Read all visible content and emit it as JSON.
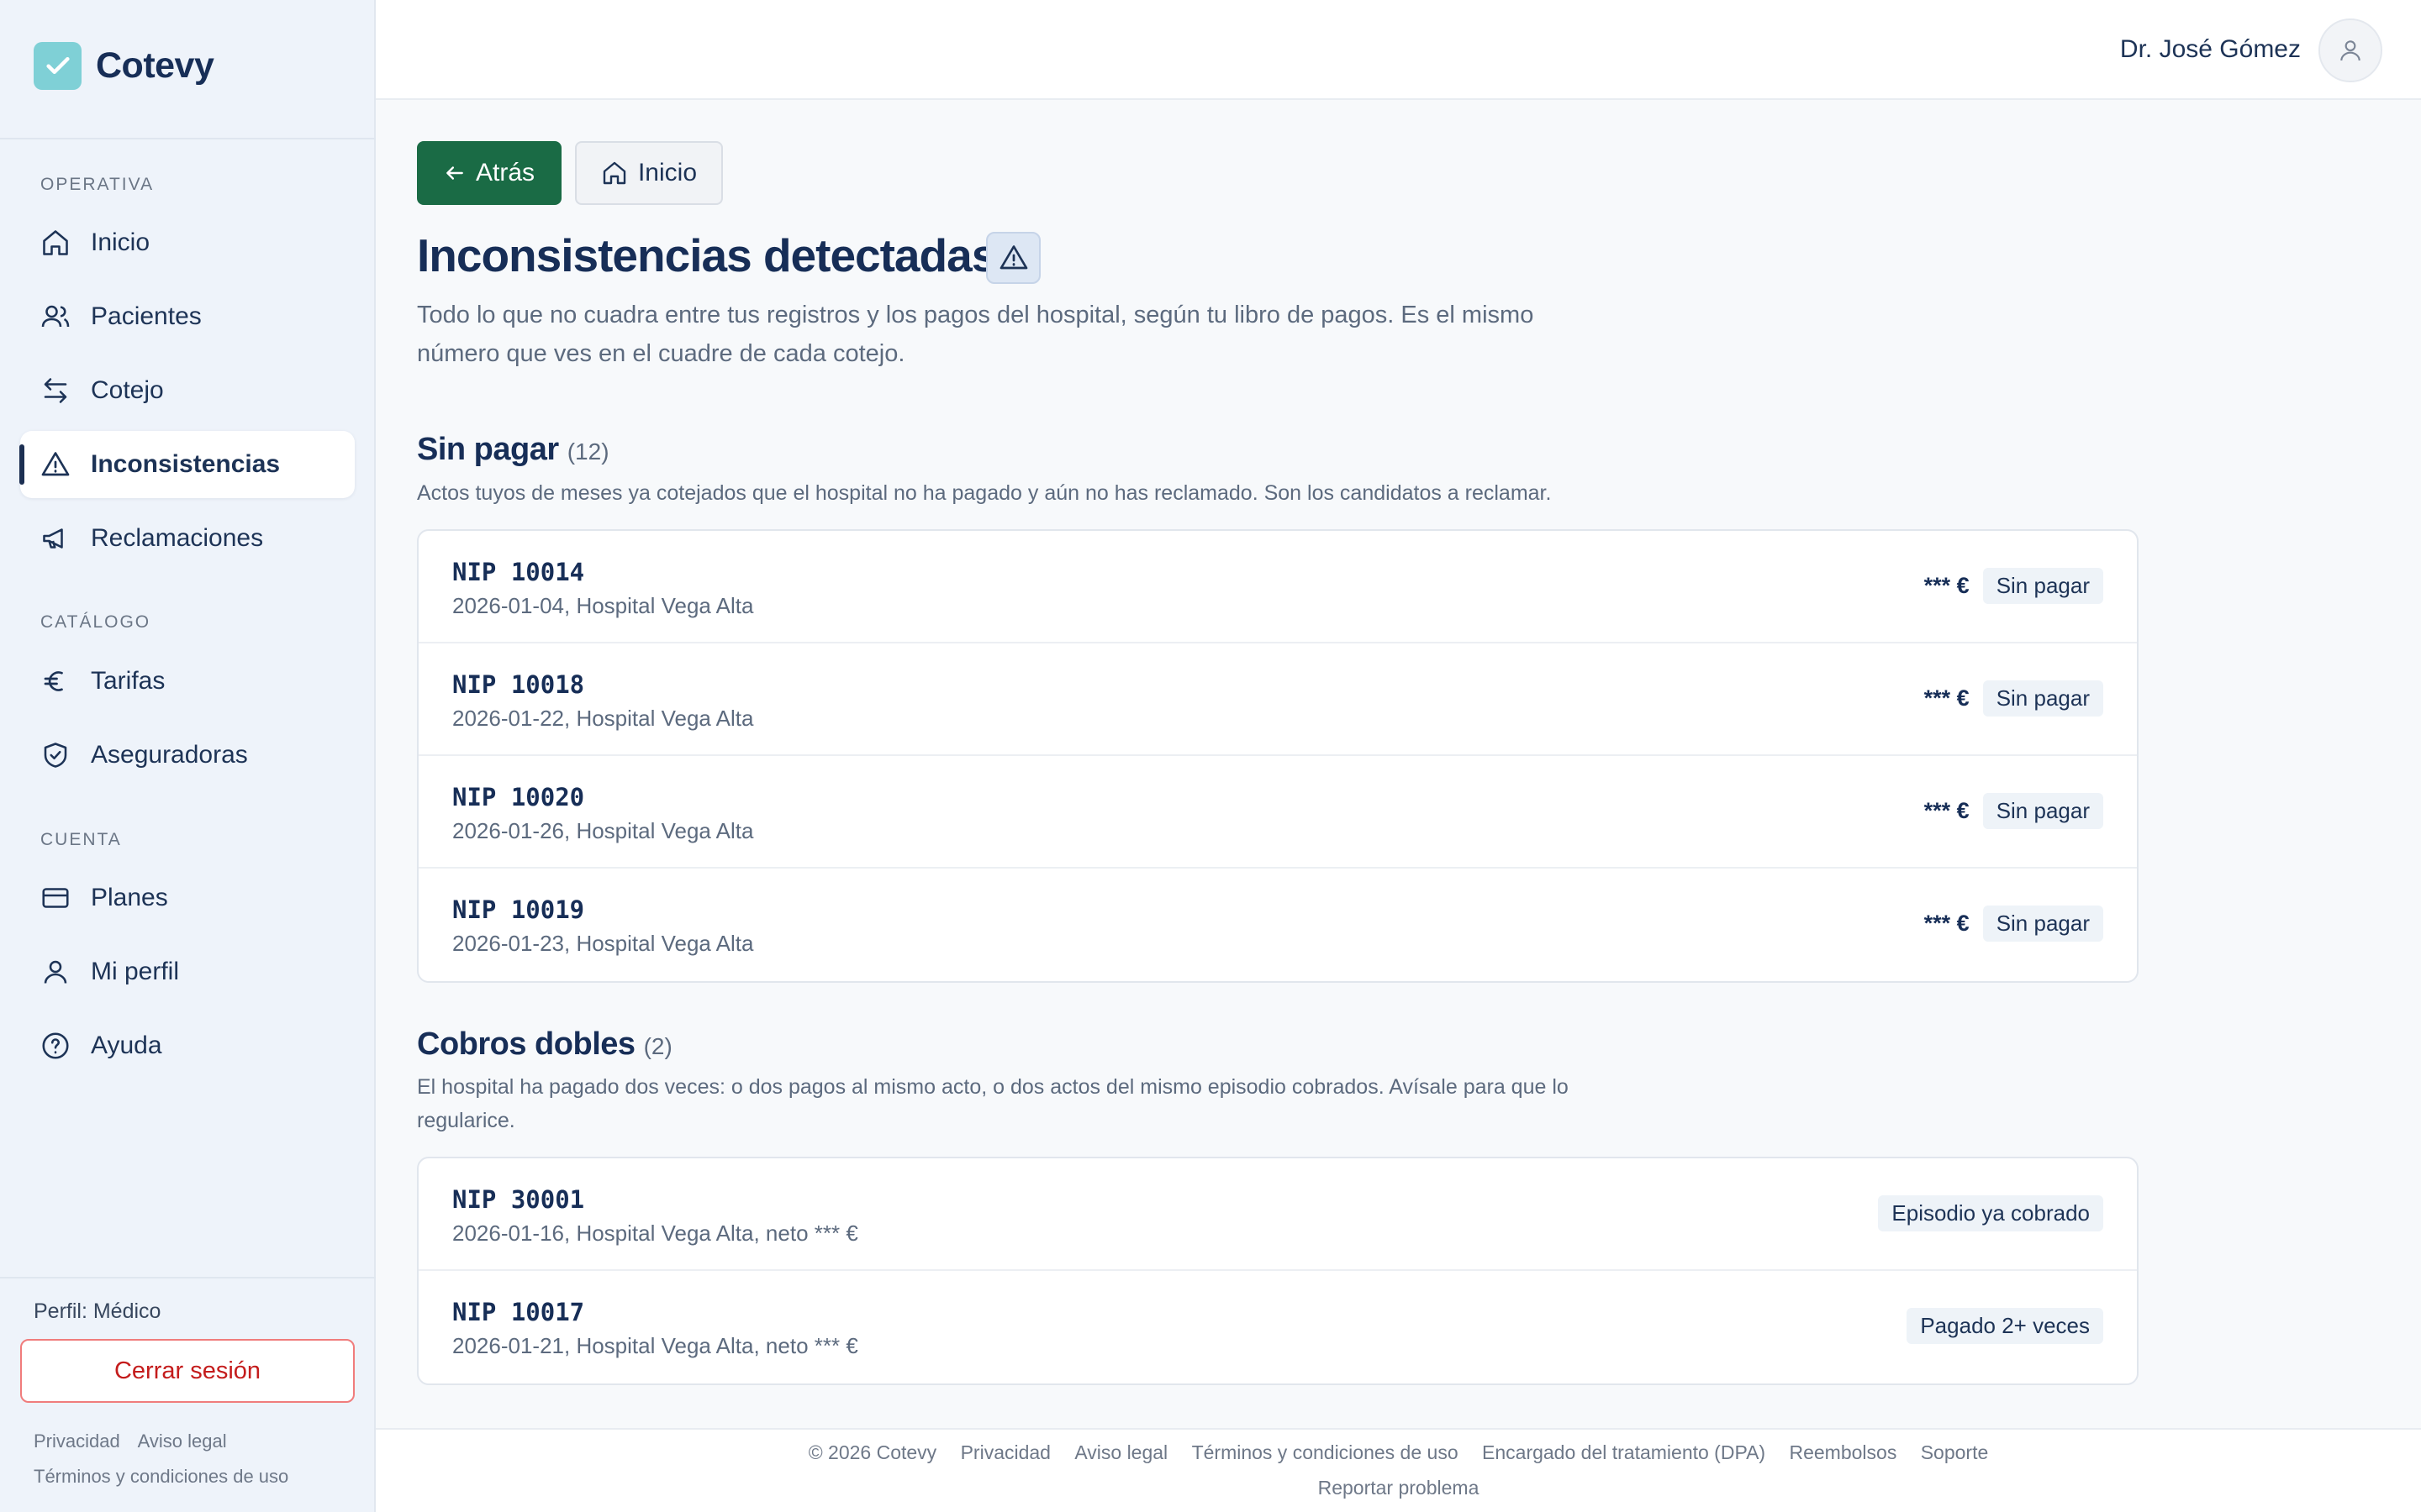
{
  "brand": {
    "name": "Cotevy"
  },
  "sidebar": {
    "sections": [
      "OPERATIVA",
      "CATÁLOGO",
      "CUENTA"
    ],
    "items": [
      {
        "label": "Inicio",
        "icon": "home-icon"
      },
      {
        "label": "Pacientes",
        "icon": "users-icon"
      },
      {
        "label": "Cotejo",
        "icon": "arrows-swap-icon"
      },
      {
        "label": "Inconsistencias",
        "icon": "warning-icon",
        "active": true
      },
      {
        "label": "Reclamaciones",
        "icon": "megaphone-icon"
      },
      {
        "label": "Tarifas",
        "icon": "euro-icon"
      },
      {
        "label": "Aseguradoras",
        "icon": "shield-check-icon"
      },
      {
        "label": "Planes",
        "icon": "credit-card-icon"
      },
      {
        "label": "Mi perfil",
        "icon": "user-icon"
      },
      {
        "label": "Ayuda",
        "icon": "help-circle-icon"
      }
    ],
    "profile_role": "Perfil: Médico",
    "logout_label": "Cerrar sesión",
    "legal_links": [
      "Privacidad",
      "Aviso legal",
      "Términos y condiciones de uso"
    ]
  },
  "topbar": {
    "user_name": "Dr. José Gómez"
  },
  "toolbar": {
    "back_label": "Atrás",
    "home_label": "Inicio"
  },
  "page": {
    "title": "Inconsistencias detectadas",
    "description": "Todo lo que no cuadra entre tus registros y los pagos del hospital, según tu libro de pagos. Es el mismo número que ves en el cuadre de cada cotejo."
  },
  "unpaid": {
    "title": "Sin pagar",
    "count": "(12)",
    "description": "Actos tuyos de meses ya cotejados que el hospital no ha pagado y aún no has reclamado. Son los candidatos a reclamar.",
    "rows": [
      {
        "nip": "NIP 10014",
        "meta": "2026-01-04, Hospital Vega Alta",
        "amount": "*** €",
        "status": "Sin pagar"
      },
      {
        "nip": "NIP 10018",
        "meta": "2026-01-22, Hospital Vega Alta",
        "amount": "*** €",
        "status": "Sin pagar"
      },
      {
        "nip": "NIP 10020",
        "meta": "2026-01-26, Hospital Vega Alta",
        "amount": "*** €",
        "status": "Sin pagar"
      },
      {
        "nip": "NIP 10019",
        "meta": "2026-01-23, Hospital Vega Alta",
        "amount": "*** €",
        "status": "Sin pagar"
      }
    ]
  },
  "double": {
    "title": "Cobros dobles",
    "count": "(2)",
    "description": "El hospital ha pagado dos veces: o dos pagos al mismo acto, o dos actos del mismo episodio cobrados. Avísale para que lo regularice.",
    "rows": [
      {
        "nip": "NIP 30001",
        "meta": "2026-01-16, Hospital Vega Alta, neto *** €",
        "status": "Episodio ya cobrado"
      },
      {
        "nip": "NIP 10017",
        "meta": "2026-01-21, Hospital Vega Alta, neto *** €",
        "status": "Pagado 2+ veces"
      }
    ]
  },
  "footer": {
    "links": [
      "© 2026 Cotevy",
      "Privacidad",
      "Aviso legal",
      "Términos y condiciones de uso",
      "Encargado del tratamiento (DPA)",
      "Reembolsos",
      "Soporte"
    ],
    "report": "Reportar problema"
  },
  "colors": {
    "primary": "#1a6b45",
    "brand_logo": "#7fd0d6",
    "danger": "#c41c1c"
  }
}
